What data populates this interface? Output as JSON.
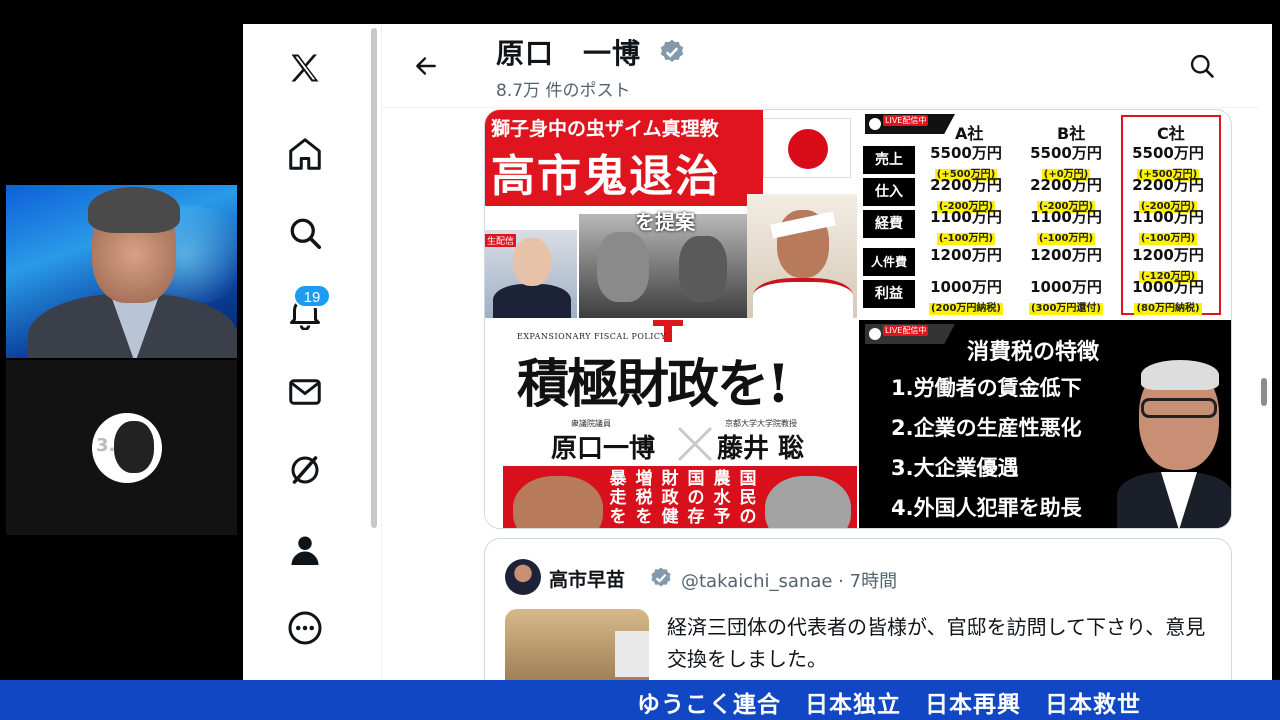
{
  "colors": {
    "x_blue": "#1d9bf0",
    "ticker_blue": "#1147c4",
    "accent_red": "#e0141e",
    "text_primary": "#0f1419",
    "text_secondary": "#536471"
  },
  "nav": {
    "items": [
      {
        "icon": "x-logo-icon"
      },
      {
        "icon": "home-icon"
      },
      {
        "icon": "search-icon"
      },
      {
        "icon": "notifications-icon"
      },
      {
        "icon": "messages-icon"
      },
      {
        "icon": "grok-icon"
      },
      {
        "icon": "profile-icon"
      },
      {
        "icon": "more-icon"
      }
    ],
    "notification_badge": "19"
  },
  "header": {
    "name": "原口　一博",
    "post_count": "8.7万 件のポスト"
  },
  "media": {
    "tile1": {
      "subtitle": "獅子身中の虫ザイム真理教",
      "title": "高市鬼退治",
      "caption": "を提案",
      "live_label": "生配信"
    },
    "tile2": {
      "live_label": "LIVE配信中",
      "columns": [
        "A社",
        "B社",
        "C社"
      ],
      "rows": [
        {
          "label": "売上",
          "cells": [
            {
              "v": "5500万円",
              "n": "(+500万円)"
            },
            {
              "v": "5500万円",
              "n": "(+0万円)"
            },
            {
              "v": "5500万円",
              "n": "(+500万円)"
            }
          ]
        },
        {
          "label": "仕入",
          "cells": [
            {
              "v": "2200万円",
              "n": "(-200万円)"
            },
            {
              "v": "2200万円",
              "n": "(-200万円)"
            },
            {
              "v": "2200万円",
              "n": "(-200万円)"
            }
          ]
        },
        {
          "label": "経費",
          "cells": [
            {
              "v": "1100万円",
              "n": "(-100万円)"
            },
            {
              "v": "1100万円",
              "n": "(-100万円)"
            },
            {
              "v": "1100万円",
              "n": "(-100万円)"
            }
          ]
        },
        {
          "label": "人件費",
          "cells": [
            {
              "v": "1200万円",
              "n": ""
            },
            {
              "v": "1200万円",
              "n": ""
            },
            {
              "v": "1200万円",
              "n": "(-120万円)"
            }
          ]
        },
        {
          "label": "利益",
          "cells": [
            {
              "v": "1000万円",
              "n": "(200万円納税)"
            },
            {
              "v": "1000万円",
              "n": "(300万円還付)"
            },
            {
              "v": "1000万円",
              "n": "(80万円納税)"
            }
          ]
        }
      ]
    },
    "tile3": {
      "en_label": "EXPANSIONARY FISCAL POLICY",
      "title": "積極財政を!",
      "role_left": "衆議院議員",
      "role_right": "京都大学大学院教授",
      "name_left": "原口一博",
      "name_right": "藤井 聡",
      "vertical": [
        "暴走を",
        "増税を",
        "財政健",
        "国の存",
        "農水予",
        "国民の"
      ]
    },
    "tile4": {
      "live_label": "LIVE配信中",
      "title": "消費税の特徴",
      "items": [
        "1.労働者の賃金低下",
        "2.企業の生産性悪化",
        "3.大企業優遇",
        "4.外国人犯罪を助長"
      ]
    }
  },
  "quote": {
    "name": "高市早苗",
    "handle_time": "@takaichi_sanae · 7時間",
    "text": "経済三団体の代表者の皆様が、官邸を訪問して下さり、意見交換をしました。"
  },
  "ticker": {
    "text": "ゆうこく連合　日本独立　日本再興　日本救世"
  }
}
